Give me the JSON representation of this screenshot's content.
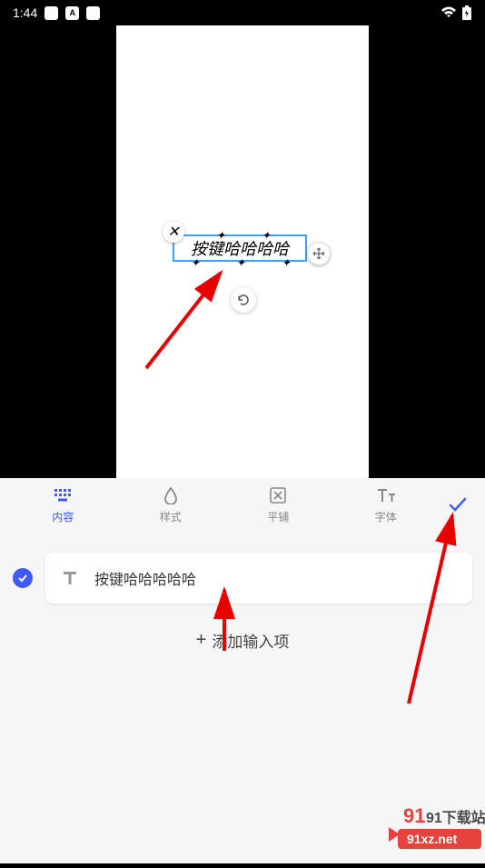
{
  "status": {
    "time": "1:44",
    "icon_a": "A"
  },
  "canvas": {
    "text_content": "按键哈哈哈哈"
  },
  "tabs": {
    "content": "内容",
    "style": "样式",
    "tile": "平铺",
    "font": "字体"
  },
  "input": {
    "value": "按键哈哈哈哈哈"
  },
  "add_item": "添加输入项",
  "watermark": {
    "brand": "91下载站",
    "url": "91xz.net"
  }
}
